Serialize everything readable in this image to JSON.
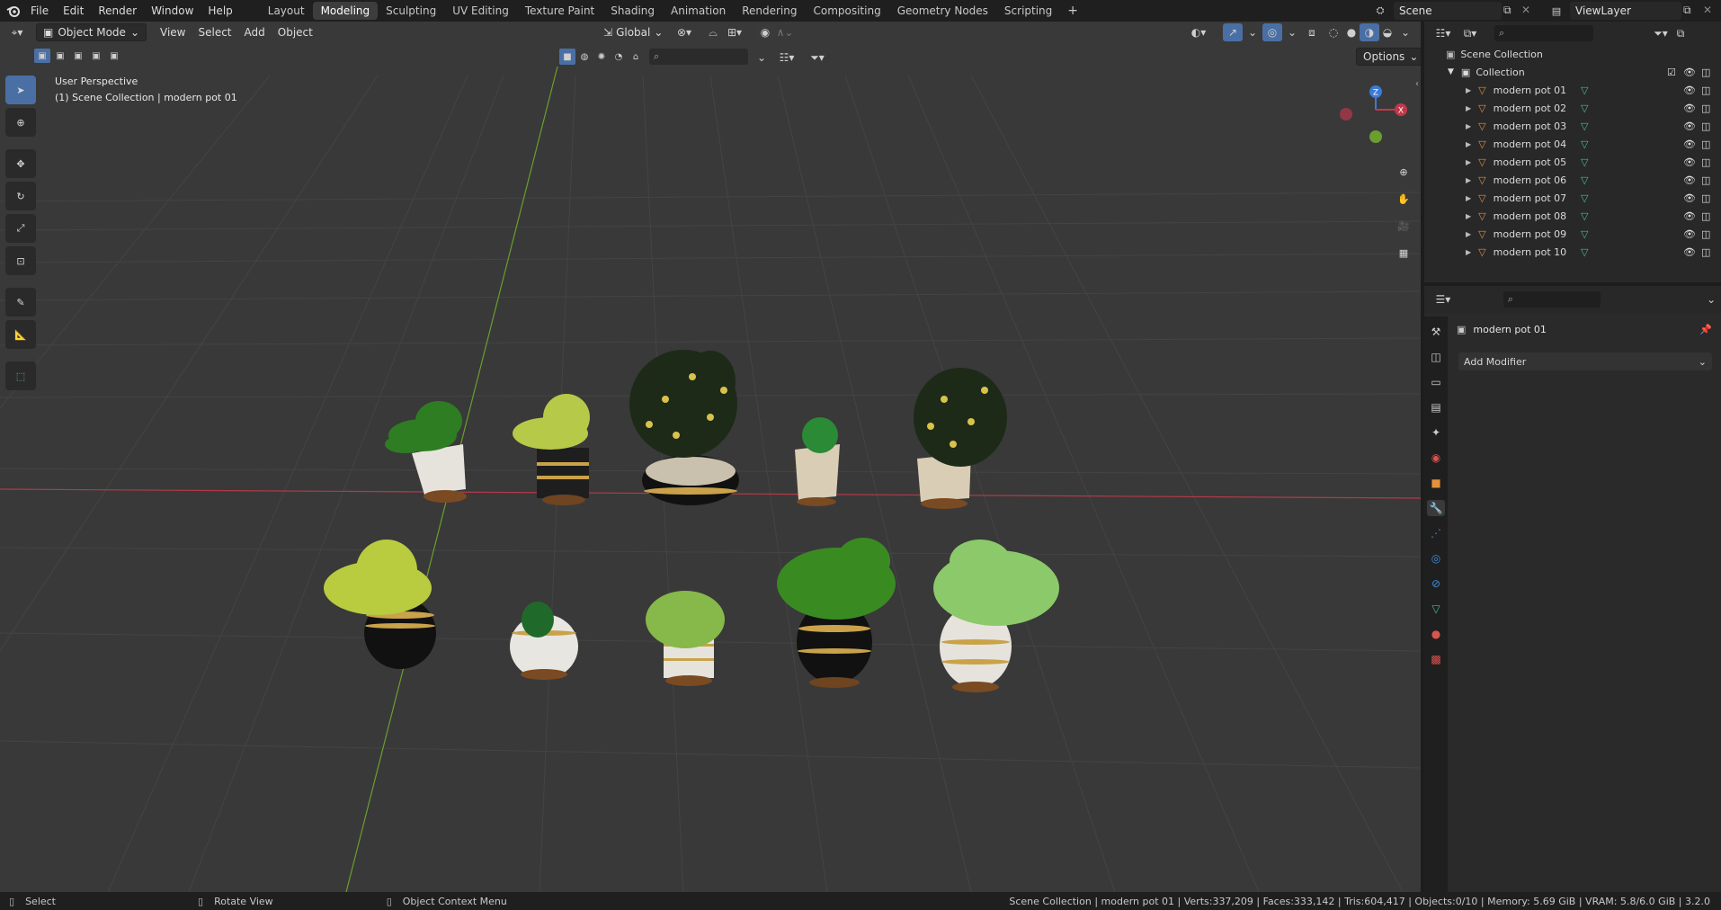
{
  "menubar": {
    "items": [
      "File",
      "Edit",
      "Render",
      "Window",
      "Help"
    ],
    "workspaces": [
      "Layout",
      "Modeling",
      "Sculpting",
      "UV Editing",
      "Texture Paint",
      "Shading",
      "Animation",
      "Rendering",
      "Compositing",
      "Geometry Nodes",
      "Scripting"
    ],
    "active_workspace": "Modeling",
    "add_tab": "+",
    "scene": "Scene",
    "view_layer": "ViewLayer"
  },
  "viewport": {
    "mode": "Object Mode",
    "menus": [
      "View",
      "Select",
      "Add",
      "Object"
    ],
    "transform_orientation": "Global",
    "options_label": "Options",
    "overlay_line1": "User Perspective",
    "overlay_line2": "(1) Scene Collection | modern pot 01",
    "gizmo": {
      "z": "Z",
      "x": "X"
    }
  },
  "outliner": {
    "root": "Scene Collection",
    "collection": "Collection",
    "objects": [
      "modern pot 01",
      "modern pot 02",
      "modern pot 03",
      "modern pot 04",
      "modern pot 05",
      "modern pot 06",
      "modern pot 07",
      "modern pot 08",
      "modern pot 09",
      "modern pot 10"
    ]
  },
  "properties": {
    "object_name": "modern pot 01",
    "add_modifier_label": "Add Modifier"
  },
  "statusbar": {
    "select": "Select",
    "rotate": "Rotate View",
    "context": "Object Context Menu",
    "stats": "Scene Collection | modern pot 01 | Verts:337,209 | Faces:333,142 | Tris:604,417 | Objects:0/10 | Memory: 5.69 GiB | VRAM: 5.8/6.0 GiB | 3.2.0"
  },
  "colors": {
    "accent": "#4a6fa5",
    "x_axis": "#c2384a",
    "y_axis": "#6a9e2e",
    "z_axis": "#3d7ad3",
    "object_icon": "#e5903c",
    "mesh_icon": "#3fc28d"
  }
}
